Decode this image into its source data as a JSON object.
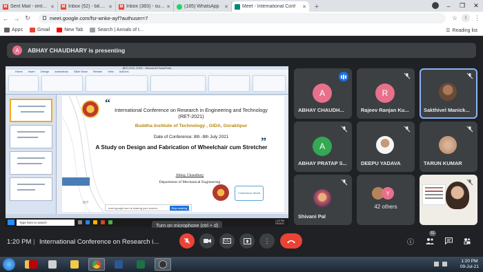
{
  "browser": {
    "tabs": [
      {
        "title": "Sent Mail - iimt@conference",
        "icon": "gmail-icon",
        "color": "#ea4335"
      },
      {
        "title": "Inbox (52) - bit.gkp@confere",
        "icon": "gmail-icon",
        "color": "#ea4335"
      },
      {
        "title": "Inbox (383) - submission@co",
        "icon": "gmail-icon",
        "color": "#ea4335"
      },
      {
        "title": "(185) WhatsApp",
        "icon": "whatsapp-icon",
        "color": "#25d366"
      },
      {
        "title": "Meet - International Conf",
        "icon": "meet-icon",
        "color": "#00897b"
      }
    ],
    "url": "meet.google.com/fsr-wnke-ayf?authuser=7",
    "bookmarks": [
      {
        "label": "Apps",
        "color": "#5f6368"
      },
      {
        "label": "Gmail",
        "color": "#ea4335"
      },
      {
        "label": "New Tab",
        "color": "#ff0000"
      },
      {
        "label": "Search | Annals of t...",
        "color": "#9aa0a6"
      }
    ],
    "reading_list": "Reading list",
    "profile_letter": "I"
  },
  "meet": {
    "presenter_initial": "A",
    "presenter_text": "ABHAY CHAUDHARY is presenting",
    "tooltip": "Turn on microphone (ctrl + d)",
    "time": "1:20 PM",
    "separator": "|",
    "meeting_title": "International Conference on Research i...",
    "chat_badge": "51",
    "participants": [
      {
        "name": "ABHAY CHAUDH...",
        "initial": "A",
        "color": "#e8708a",
        "speaking": true
      },
      {
        "name": "Rajeev Ranjan Ku...",
        "initial": "R",
        "color": "#e8708a"
      },
      {
        "name": "Sakthivel Manick...",
        "photo": "#6b4a34",
        "highlighted": true
      },
      {
        "name": "ABHAY PRATAP S...",
        "initial": "A",
        "color": "#34a853"
      },
      {
        "name": "DEEPU YADAVA",
        "photo": "#4a5a6a"
      },
      {
        "name": "TARUN KUMAR",
        "photo": "#c49a7a"
      },
      {
        "name": "Shivani Pal",
        "photo": "#c85a6a"
      },
      {
        "name": "",
        "others_label": "42 others",
        "others_initial": "Y"
      }
    ]
  },
  "slide": {
    "window_title": "[BIT] 2021 2020 ~ Microsoft PowerPoint",
    "ribbon_tabs": [
      "Home",
      "Insert",
      "Design",
      "Animations",
      "Slide Show",
      "Review",
      "View",
      "Add-Ins"
    ],
    "quote_open": "“",
    "quote_close": "”",
    "title": "International Conference on Research in Engineering and Technology (RET-2021)",
    "institute": "Buddha Institute of Technology , GIDA, Gorakhpur",
    "dates": "Date of Conference: 8th -9th July 2021",
    "paper_title": "A Study on Design and Fabrication of Wheelchair cum Stretcher",
    "author": "Abhay Chaudhary",
    "department": "Department of Mechanical Engineering",
    "watermark": "BIT",
    "conference_logo_text": "Conference World",
    "share_notice": "meet.google.com is sharing your screen.",
    "stop_sharing": "Stop sharing",
    "search_placeholder": "Type here to search",
    "remote_clock_time": "1:20 PM",
    "remote_clock_date": "7/9/2021"
  },
  "taskbar": {
    "clock_time": "1:20 PM",
    "clock_date": "09-Jul-21",
    "apps": [
      "folder-icon",
      "filezilla-icon",
      "tool-icon",
      "explorer-icon",
      "chrome-icon",
      "word-icon",
      "excel-icon",
      "camera-icon"
    ]
  }
}
